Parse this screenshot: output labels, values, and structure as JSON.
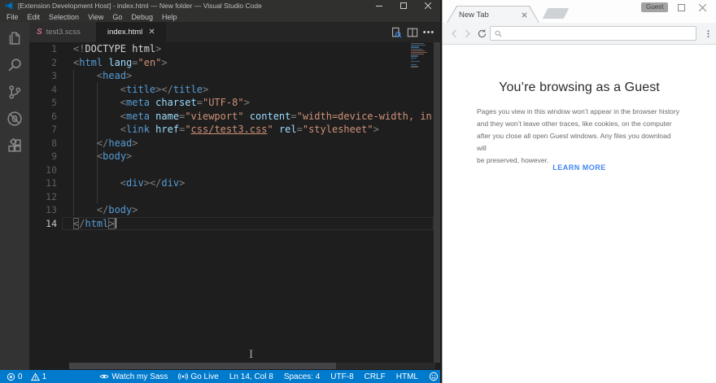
{
  "colors": {
    "statusbar_bg": "#007acc",
    "editor_bg": "#1e1e1e",
    "activitybar_bg": "#333333",
    "tag_blue": "#569cd6",
    "attr_blue": "#9cdcfe",
    "string_orange": "#ce9178",
    "html_icon_orange": "#e44d26",
    "sass_icon_pink": "#cd6799",
    "chrome_link_blue": "#4285f4"
  },
  "vscode": {
    "window_title": "[Extension Development Host] - index.html — New folder — Visual Studio Code",
    "menus": [
      "File",
      "Edit",
      "Selection",
      "View",
      "Go",
      "Debug",
      "Help"
    ],
    "activity_bar_icons": [
      "files-icon",
      "search-icon",
      "source-control-icon",
      "debug-icon",
      "extensions-icon"
    ],
    "tabs": [
      {
        "label": "test3.scss",
        "icon": "sass-icon",
        "active": false
      },
      {
        "label": "index.html",
        "icon": "html-icon",
        "active": true
      }
    ],
    "editor": {
      "lines": [
        {
          "n": 1,
          "tk": [
            [
              "p",
              "<!"
            ],
            [
              "w",
              "DOCTYPE html"
            ],
            [
              "p",
              ">"
            ]
          ]
        },
        {
          "n": 2,
          "tk": [
            [
              "p",
              "<"
            ],
            [
              "t",
              "html"
            ],
            [
              "w",
              " "
            ],
            [
              "a",
              "lang"
            ],
            [
              "p",
              "="
            ],
            [
              "s",
              "\"en\""
            ],
            [
              "p",
              ">"
            ]
          ]
        },
        {
          "n": 3,
          "tk": [
            [
              "w",
              "    "
            ],
            [
              "p",
              "<"
            ],
            [
              "t",
              "head"
            ],
            [
              "p",
              ">"
            ]
          ]
        },
        {
          "n": 4,
          "tk": [
            [
              "w",
              "        "
            ],
            [
              "p",
              "<"
            ],
            [
              "t",
              "title"
            ],
            [
              "p",
              "></"
            ],
            [
              "t",
              "title"
            ],
            [
              "p",
              ">"
            ]
          ]
        },
        {
          "n": 5,
          "tk": [
            [
              "w",
              "        "
            ],
            [
              "p",
              "<"
            ],
            [
              "t",
              "meta"
            ],
            [
              "w",
              " "
            ],
            [
              "a",
              "charset"
            ],
            [
              "p",
              "="
            ],
            [
              "s",
              "\"UTF-8\""
            ],
            [
              "p",
              ">"
            ]
          ]
        },
        {
          "n": 6,
          "tk": [
            [
              "w",
              "        "
            ],
            [
              "p",
              "<"
            ],
            [
              "t",
              "meta"
            ],
            [
              "w",
              " "
            ],
            [
              "a",
              "name"
            ],
            [
              "p",
              "="
            ],
            [
              "s",
              "\"viewport\""
            ],
            [
              "w",
              " "
            ],
            [
              "a",
              "content"
            ],
            [
              "p",
              "="
            ],
            [
              "s",
              "\"width=device-width, in"
            ]
          ]
        },
        {
          "n": 7,
          "tk": [
            [
              "w",
              "        "
            ],
            [
              "p",
              "<"
            ],
            [
              "t",
              "link"
            ],
            [
              "w",
              " "
            ],
            [
              "a",
              "href"
            ],
            [
              "p",
              "="
            ],
            [
              "s",
              "\""
            ],
            [
              "su",
              "css/test3.css"
            ],
            [
              "s",
              "\""
            ],
            [
              "w",
              " "
            ],
            [
              "a",
              "rel"
            ],
            [
              "p",
              "="
            ],
            [
              "s",
              "\"stylesheet\""
            ],
            [
              "p",
              ">"
            ]
          ]
        },
        {
          "n": 8,
          "tk": [
            [
              "w",
              "    "
            ],
            [
              "p",
              "</"
            ],
            [
              "t",
              "head"
            ],
            [
              "p",
              ">"
            ]
          ]
        },
        {
          "n": 9,
          "tk": [
            [
              "w",
              "    "
            ],
            [
              "p",
              "<"
            ],
            [
              "t",
              "body"
            ],
            [
              "p",
              ">"
            ]
          ]
        },
        {
          "n": 10,
          "tk": []
        },
        {
          "n": 11,
          "tk": [
            [
              "w",
              "        "
            ],
            [
              "p",
              "<"
            ],
            [
              "t",
              "div"
            ],
            [
              "p",
              "></"
            ],
            [
              "t",
              "div"
            ],
            [
              "p",
              ">"
            ]
          ]
        },
        {
          "n": 12,
          "tk": []
        },
        {
          "n": 13,
          "tk": [
            [
              "w",
              "    "
            ],
            [
              "p",
              "</"
            ],
            [
              "t",
              "body"
            ],
            [
              "p",
              ">"
            ]
          ]
        },
        {
          "n": 14,
          "tk": [
            [
              "bm",
              "<"
            ],
            [
              "p",
              "/"
            ],
            [
              "t",
              "html"
            ],
            [
              "bm",
              ">"
            ]
          ],
          "cur": true
        }
      ]
    },
    "status_left": [
      {
        "icon": "error-icon",
        "label": "0",
        "name": "errors-count"
      },
      {
        "icon": "warning-icon",
        "label": "1",
        "name": "warnings-count"
      }
    ],
    "status_right": [
      {
        "icon": "eye-icon",
        "label": "Watch my Sass",
        "name": "watch-my-sass"
      },
      {
        "icon": "broadcast-icon",
        "label": "Go Live",
        "name": "go-live"
      },
      {
        "label": "Ln 14, Col 8",
        "name": "cursor-position"
      },
      {
        "label": "Spaces: 4",
        "name": "indentation"
      },
      {
        "label": "UTF-8",
        "name": "encoding"
      },
      {
        "label": "CRLF",
        "name": "eol"
      },
      {
        "label": "HTML",
        "name": "language-mode"
      },
      {
        "icon": "smiley-icon",
        "label": "",
        "name": "feedback"
      }
    ]
  },
  "chrome": {
    "profile_badge": "Guest",
    "tab_title": "New Tab",
    "address_value": "",
    "address_placeholder": "",
    "page": {
      "heading": "You’re browsing as a Guest",
      "body_lines": [
        "Pages you view in this window won’t appear in the browser history",
        "and they won’t leave other traces, like cookies, on the computer",
        "after you close all open Guest windows. Any files you download will",
        "be preserved, however."
      ],
      "link_label": "LEARN MORE"
    }
  }
}
